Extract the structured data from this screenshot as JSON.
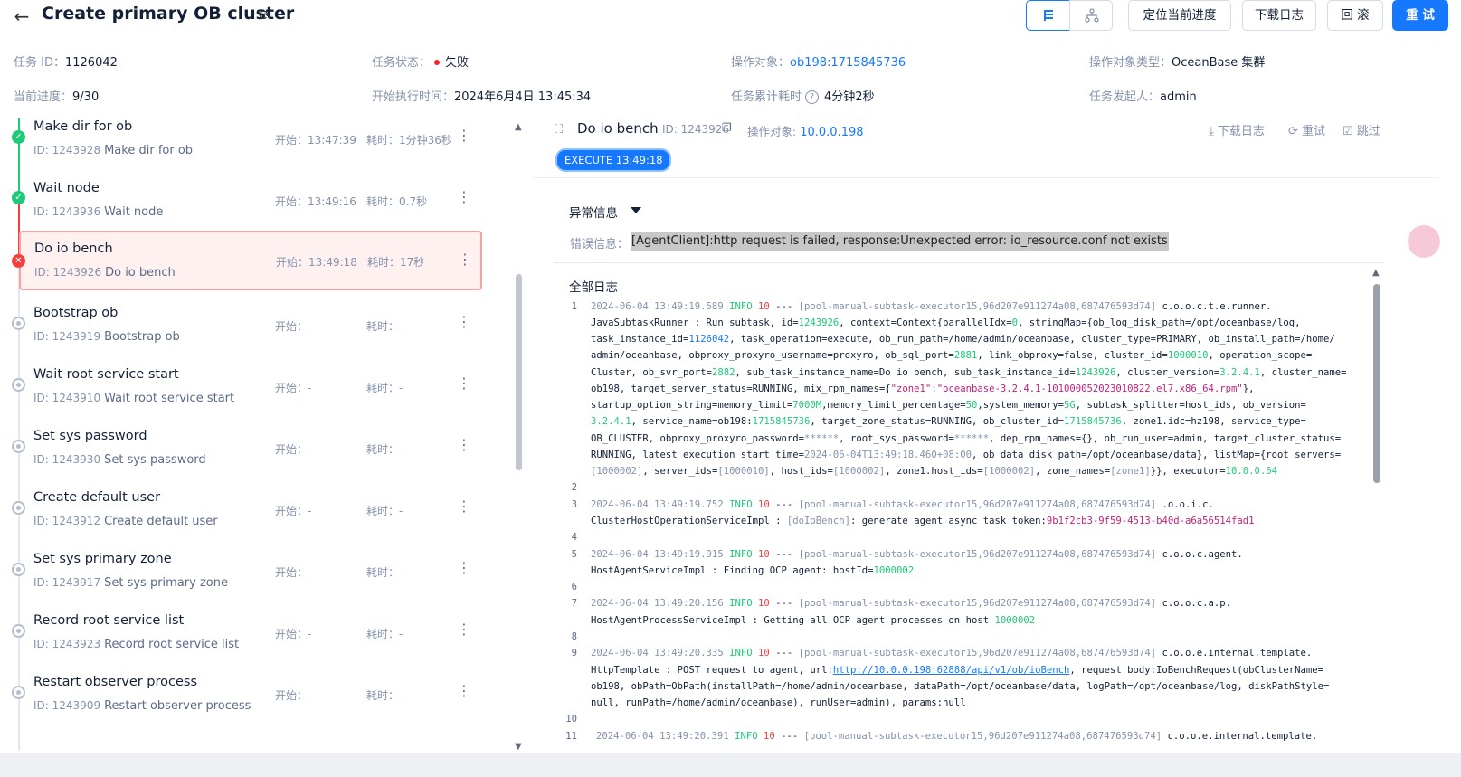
{
  "header": {
    "title": "Create primary OB cluster",
    "buttons": {
      "locate": "定位当前进度",
      "download_log": "下载日志",
      "rollback": "回 滚",
      "retry": "重 试"
    }
  },
  "info": {
    "task_id": {
      "label": "任务 ID：",
      "value": "1126042"
    },
    "task_status": {
      "label": "任务状态：",
      "value": "失败"
    },
    "target": {
      "label": "操作对象：",
      "value": "ob198:1715845736"
    },
    "target_type": {
      "label": "操作对象类型：",
      "value": "OceanBase 集群"
    },
    "progress": {
      "label": "当前进度：",
      "value": "9/30"
    },
    "start_time": {
      "label": "开始执行时间：",
      "value": "2024年6月4日 13:45:34"
    },
    "elapsed": {
      "label": "任务累计耗时",
      "value": "4分钟2秒"
    },
    "initiator": {
      "label": "任务发起人：",
      "value": "admin"
    }
  },
  "task_list": {
    "start_label": "开始：",
    "cost_label": "耗时：",
    "items": [
      {
        "name": "Make dir for ob",
        "id_label": "ID: 1243928",
        "sub": "Make dir for ob",
        "start": "开始：13:47:39",
        "cost": "耗时：1分钟36秒",
        "status": "success"
      },
      {
        "name": "Wait node",
        "id_label": "ID: 1243936",
        "sub": "Wait node",
        "start": "开始：13:49:16",
        "cost": "耗时：0.7秒",
        "status": "success"
      },
      {
        "name": "Do io bench",
        "id_label": "ID: 1243926",
        "sub": "Do io bench",
        "start": "开始：13:49:18",
        "cost": "耗时：17秒",
        "status": "failed"
      },
      {
        "name": "Bootstrap ob",
        "id_label": "ID: 1243919",
        "sub": "Bootstrap ob",
        "start": "开始：-",
        "cost": "耗时：-",
        "status": "pending"
      },
      {
        "name": "Wait root service start",
        "id_label": "ID: 1243910",
        "sub": "Wait root service start",
        "start": "开始：-",
        "cost": "耗时：-",
        "status": "pending"
      },
      {
        "name": "Set sys password",
        "id_label": "ID: 1243930",
        "sub": "Set sys password",
        "start": "开始：-",
        "cost": "耗时：-",
        "status": "pending"
      },
      {
        "name": "Create default user",
        "id_label": "ID: 1243912",
        "sub": "Create default user",
        "start": "开始：-",
        "cost": "耗时：-",
        "status": "pending"
      },
      {
        "name": "Set sys primary zone",
        "id_label": "ID: 1243917",
        "sub": "Set sys primary zone",
        "start": "开始：-",
        "cost": "耗时：-",
        "status": "pending"
      },
      {
        "name": "Record root service list",
        "id_label": "ID: 1243923",
        "sub": "Record root service list",
        "start": "开始：-",
        "cost": "耗时：-",
        "status": "pending"
      },
      {
        "name": "Restart observer process",
        "id_label": "ID: 1243909",
        "sub": "Restart observer process",
        "start": "开始：-",
        "cost": "耗时：-",
        "status": "pending"
      }
    ]
  },
  "detail": {
    "title": "Do io bench",
    "id_label": "ID: 1243926",
    "target_label": "操作对象:",
    "target_value": "10.0.0.198",
    "actions": {
      "download": "下载日志",
      "retry": "重试",
      "skip": "跳过"
    },
    "badge": "EXECUTE 13:49:18",
    "exception_header": "异常信息",
    "error_label": "错误信息：",
    "error_value": "[AgentClient]:http request is failed, response:Unexpected error: io_resource.conf not exists",
    "log_header": "全部日志"
  },
  "colors": {
    "primary": "#1677ff",
    "success": "#1ec97a",
    "error": "#f53f3f",
    "muted": "#8592ad"
  }
}
